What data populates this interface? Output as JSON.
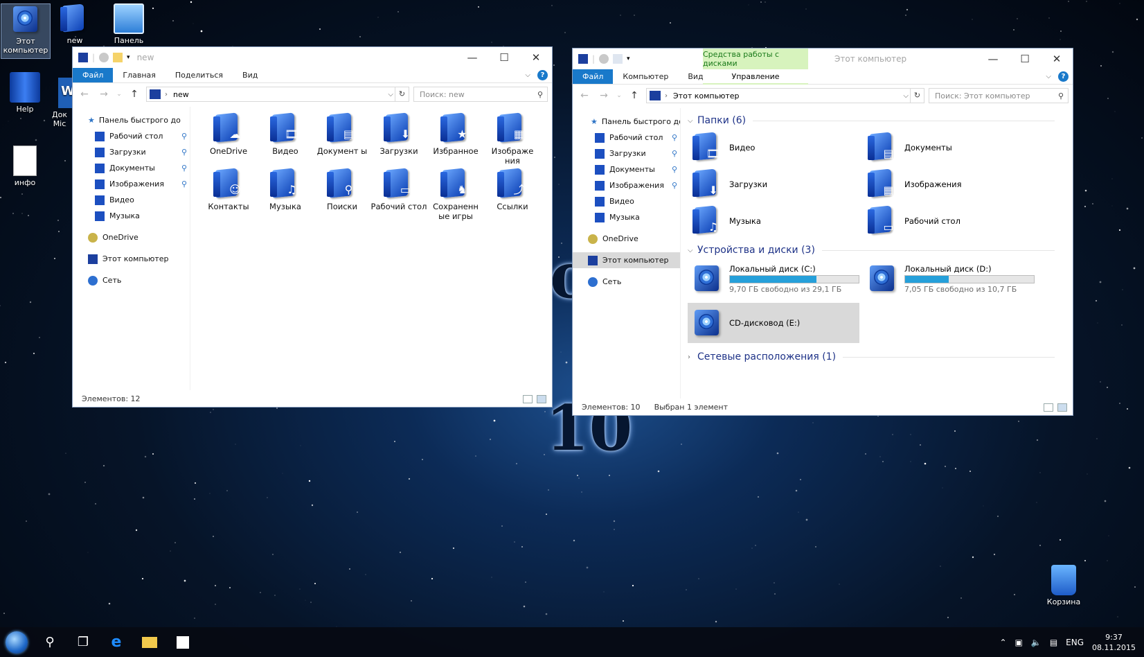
{
  "desktop": {
    "icons": [
      {
        "label": "Этот компьютер"
      },
      {
        "label": "new"
      },
      {
        "label": "Панель"
      },
      {
        "label": "Help"
      },
      {
        "label": "Док Mic"
      },
      {
        "label": "инфо"
      },
      {
        "label": "Корзина"
      }
    ],
    "wallpaper_text": "10"
  },
  "left_window": {
    "title": "new",
    "ribbon_tabs": [
      "Файл",
      "Главная",
      "Поделиться",
      "Вид"
    ],
    "address": "new",
    "search_placeholder": "Поиск: new",
    "nav": {
      "quick_access": "Панель быстрого до",
      "pinned": [
        "Рабочий стол",
        "Загрузки",
        "Документы",
        "Изображения"
      ],
      "unpinned": [
        "Видео",
        "Музыка"
      ],
      "onedrive": "OneDrive",
      "this_pc": "Этот компьютер",
      "network": "Сеть"
    },
    "items": [
      {
        "label": "OneDrive",
        "icon": "onedrive-folder-icon"
      },
      {
        "label": "Видео",
        "icon": "video-folder-icon"
      },
      {
        "label": "Документ ы",
        "icon": "documents-folder-icon"
      },
      {
        "label": "Загрузки",
        "icon": "downloads-folder-icon"
      },
      {
        "label": "Избранное",
        "icon": "favorites-folder-icon"
      },
      {
        "label": "Изображе ния",
        "icon": "pictures-folder-icon"
      },
      {
        "label": "Контакты",
        "icon": "contacts-folder-icon"
      },
      {
        "label": "Музыка",
        "icon": "music-folder-icon"
      },
      {
        "label": "Поиски",
        "icon": "searches-folder-icon"
      },
      {
        "label": "Рабочий стол",
        "icon": "desktop-folder-icon"
      },
      {
        "label": "Сохраненн ые игры",
        "icon": "saved-games-folder-icon"
      },
      {
        "label": "Ссылки",
        "icon": "links-folder-icon"
      }
    ],
    "status": "Элементов: 12"
  },
  "right_window": {
    "title": "Этот компьютер",
    "tool_tab": "Средства работы с дисками",
    "tool_subtab": "Управление",
    "ribbon_tabs": [
      "Файл",
      "Компьютер",
      "Вид"
    ],
    "address": "Этот компьютер",
    "search_placeholder": "Поиск: Этот компьютер",
    "nav": {
      "quick_access": "Панель быстрого дс",
      "pinned": [
        "Рабочий стол",
        "Загрузки",
        "Документы",
        "Изображения"
      ],
      "unpinned": [
        "Видео",
        "Музыка"
      ],
      "onedrive": "OneDrive",
      "this_pc": "Этот компьютер",
      "network": "Сеть"
    },
    "groups": {
      "folders": "Папки (6)",
      "devices": "Устройства и диски (3)",
      "network": "Сетевые расположения (1)"
    },
    "folders": [
      {
        "label": "Видео",
        "icon": "video-folder-icon"
      },
      {
        "label": "Документы",
        "icon": "documents-folder-icon"
      },
      {
        "label": "Загрузки",
        "icon": "downloads-folder-icon"
      },
      {
        "label": "Изображения",
        "icon": "pictures-folder-icon"
      },
      {
        "label": "Музыка",
        "icon": "music-folder-icon"
      },
      {
        "label": "Рабочий стол",
        "icon": "desktop-folder-icon"
      }
    ],
    "drives": [
      {
        "label": "Локальный диск (C:)",
        "free": "9,70 ГБ свободно из 29,1 ГБ",
        "used_fraction": 0.67
      },
      {
        "label": "Локальный диск (D:)",
        "free": "7,05 ГБ свободно из 10,7 ГБ",
        "used_fraction": 0.34
      },
      {
        "label": "CD-дисковод (E:)"
      }
    ],
    "status_count": "Элементов: 10",
    "status_selected": "Выбран 1 элемент"
  },
  "taskbar": {
    "lang": "ENG",
    "time": "9:37",
    "date": "08.11.2015"
  },
  "colors": {
    "accent": "#1979ca",
    "tool_tab": "#d7f3bd",
    "progress": "#26a0da"
  }
}
